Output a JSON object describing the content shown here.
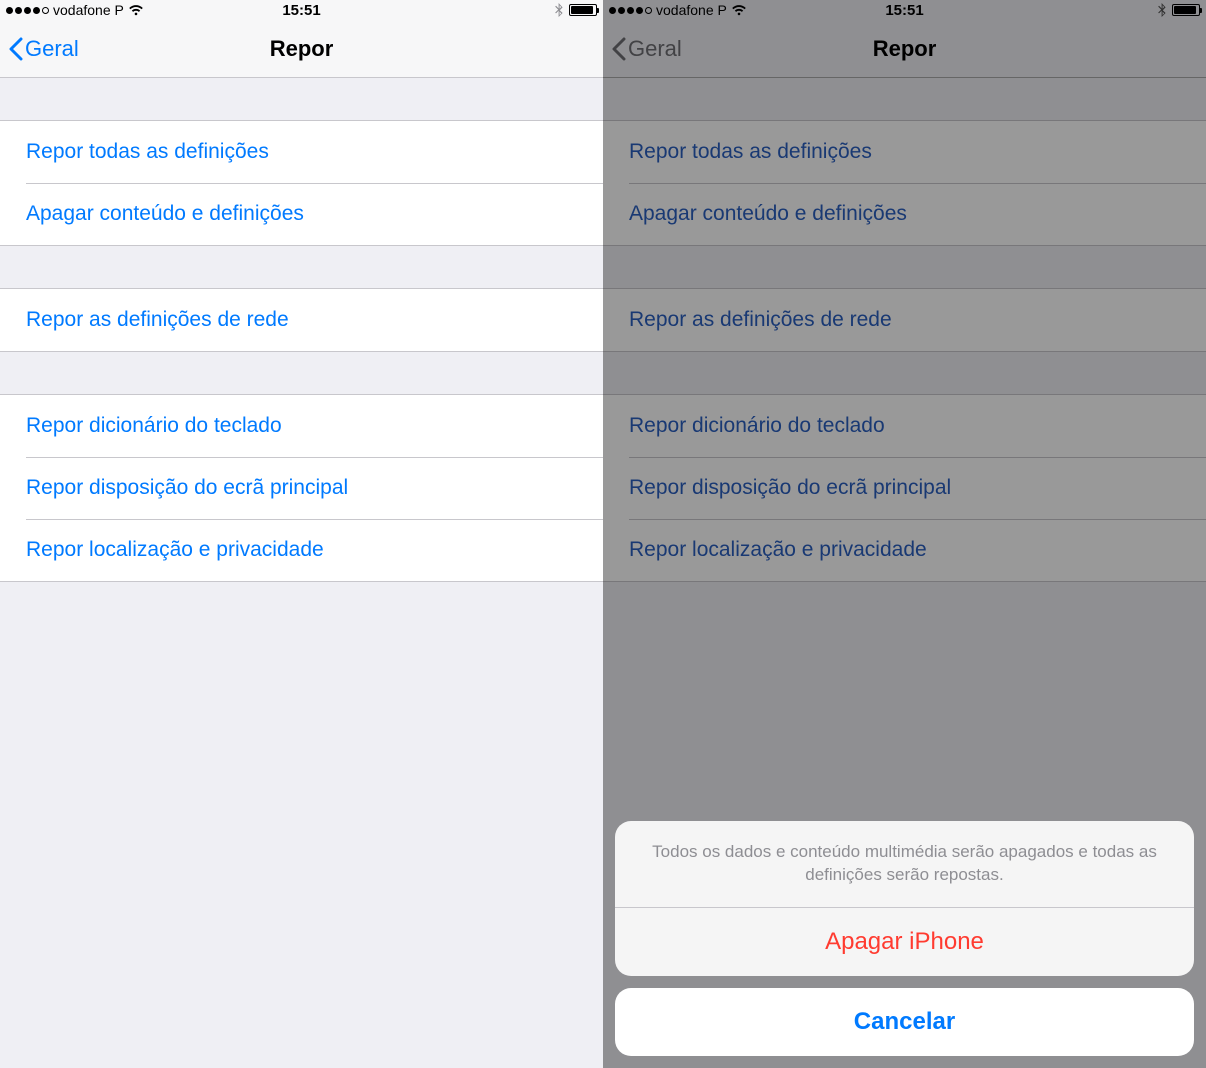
{
  "status": {
    "carrier": "vodafone P",
    "time": "15:51"
  },
  "nav": {
    "back_label": "Geral",
    "title": "Repor"
  },
  "groups": {
    "g1": {
      "reset_all_settings": "Repor todas as definições",
      "erase_content": "Apagar conteúdo e definições"
    },
    "g2": {
      "reset_network": "Repor as definições de rede"
    },
    "g3": {
      "reset_keyboard": "Repor dicionário do teclado",
      "reset_home_layout": "Repor disposição do ecrã principal",
      "reset_location_privacy": "Repor localização e privacidade"
    }
  },
  "action_sheet": {
    "message": "Todos os dados e conteúdo multimédia serão apagados e todas as definições serão repostas.",
    "destructive_label": "Apagar iPhone",
    "cancel_label": "Cancelar"
  },
  "colors": {
    "ios_blue": "#007aff",
    "ios_red": "#ff3b30",
    "ios_gray_bg": "#efeff4",
    "separator": "#c8c7cc"
  }
}
